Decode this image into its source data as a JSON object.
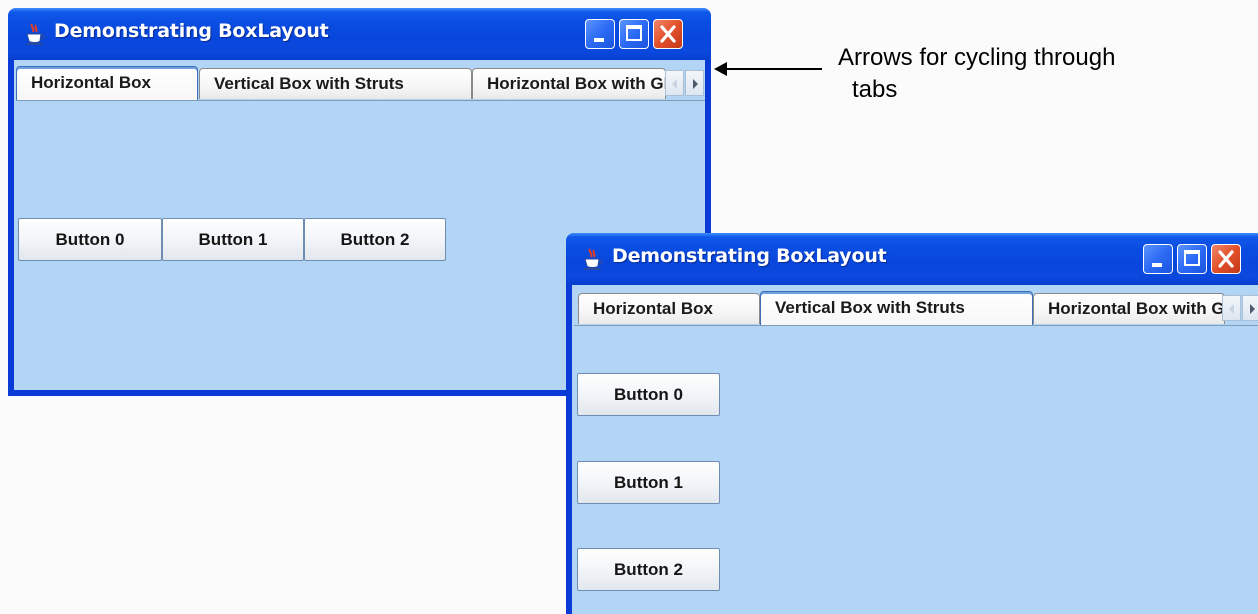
{
  "windows": [
    {
      "title": "Demonstrating BoxLayout",
      "tabs": [
        {
          "label": "Horizontal Box",
          "selected": true
        },
        {
          "label": "Vertical Box with Struts",
          "selected": false
        },
        {
          "label": "Horizontal Box with Glue",
          "selected": false
        }
      ],
      "buttons": [
        "Button 0",
        "Button 1",
        "Button 2"
      ]
    },
    {
      "title": "Demonstrating BoxLayout",
      "tabs": [
        {
          "label": "Horizontal Box",
          "selected": false
        },
        {
          "label": "Vertical Box with Struts",
          "selected": true
        },
        {
          "label": "Horizontal Box with Glue",
          "selected": false
        }
      ],
      "buttons": [
        "Button 0",
        "Button 1",
        "Button 2"
      ]
    }
  ],
  "annotation": {
    "line1": "Arrows for cycling through",
    "line2": "tabs"
  },
  "icons": {
    "window_icon": "java-coffee-cup-icon",
    "minimize": "minimize-icon",
    "maximize": "maximize-icon",
    "close": "close-icon",
    "scroll_left": "scroll-left-arrow-icon",
    "scroll_right": "scroll-right-arrow-icon"
  },
  "colors": {
    "titlebar": "#0a4de1",
    "close_button": "#e2502a",
    "client_background": "#b3d5f5",
    "selected_tab_border": "#3c6fb8"
  }
}
